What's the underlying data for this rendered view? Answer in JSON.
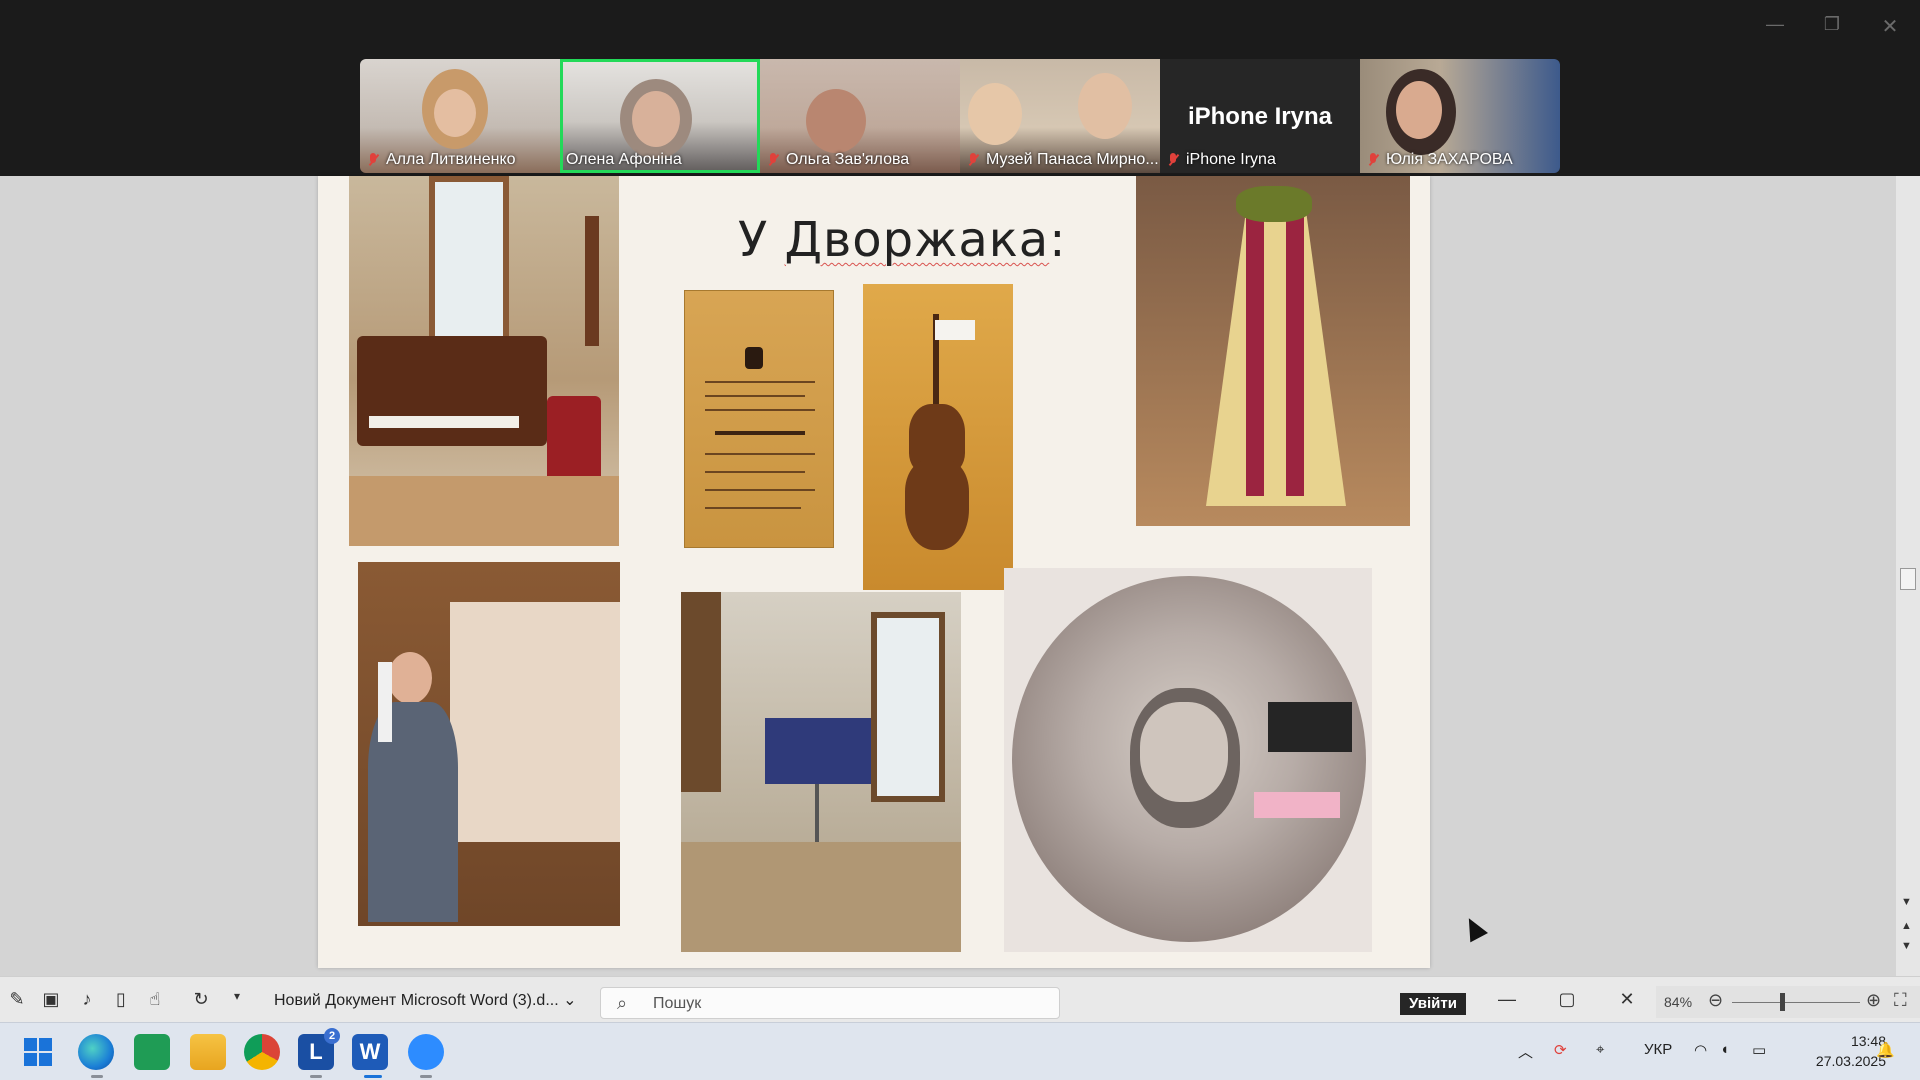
{
  "zoom": {
    "participants": [
      {
        "name": "Алла Литвиненко",
        "muted": true
      },
      {
        "name": "Олена Афоніна",
        "muted": false,
        "active_speaker": true
      },
      {
        "name": "Ольга Зав'ялова",
        "muted": true
      },
      {
        "name": "Музей Панаса Мирно...",
        "muted": true
      },
      {
        "name": "iPhone Iryna",
        "muted": true,
        "center_label": "iPhone Iryna"
      },
      {
        "name": "Юлія ЗАХАРОВА",
        "muted": true
      }
    ],
    "window_controls": {
      "minimize": "—",
      "restore": "❐",
      "close": "✕"
    }
  },
  "document": {
    "title_prefix": "У ",
    "title_word": "Дворжака",
    "title_suffix": ":"
  },
  "word_bar": {
    "doc_name": "Новий Документ Microsoft Word (3).d...",
    "search_placeholder": "Пошук",
    "signin_label": "Увійти",
    "zoom_level": "84%"
  },
  "taskbar": {
    "language": "УКР",
    "time": "13:48",
    "date": "27.03.2025",
    "l_badge": "2"
  },
  "colors": {
    "active_speaker": "#23d959",
    "muted_mic": "#e0413b",
    "page_bg": "#f5f1ea"
  }
}
